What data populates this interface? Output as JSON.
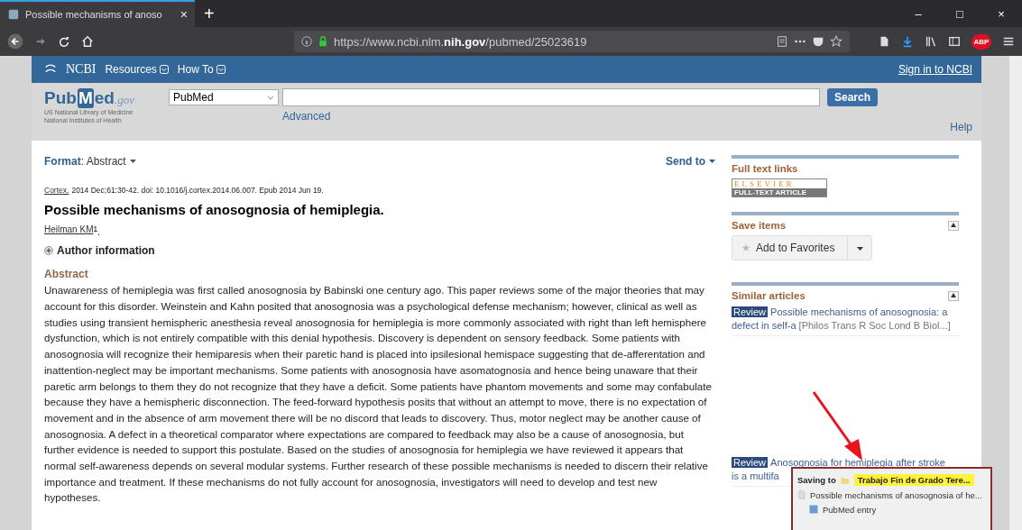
{
  "browser": {
    "tab": {
      "title": "Possible mechanisms of anoso",
      "close": "×"
    },
    "new_tab": "+",
    "window_controls": [
      "–",
      "□",
      "×"
    ],
    "url": "https://www.ncbi.nlm.**nih.gov**/pubmed/25023619",
    "adblock_badge": "ABP"
  },
  "ncbi_bar": {
    "logo": "NCBI",
    "menus": [
      {
        "label": "Resources"
      },
      {
        "label": "How To"
      }
    ],
    "sign_in": "Sign in to NCBI"
  },
  "pubmed_header": {
    "logo_parts": [
      "Pub",
      "M",
      "ed",
      ".gov"
    ],
    "org_lines": [
      "US National Library of Medicine",
      "National Institutes of Health"
    ],
    "database": "PubMed",
    "advanced": "Advanced",
    "search_button": "Search",
    "help": "Help"
  },
  "article": {
    "format": "**Format**: Abstract",
    "send_to": "Send to",
    "journal": "Cortex.",
    "citation": "2014 Dec;61:30-42. doi: 10.1016/j.cortex.2014.06.007. Epub 2014 Jun 19.",
    "title": "Possible mechanisms of anosognosia of hemiplegia.",
    "author": "Heilman KM",
    "author_note": "$^{1}$.",
    "author_info": "Author information",
    "abstract_heading": "Abstract",
    "abstract": "Unawareness of hemiplegia was first called anosognosia by Babinski one century ago. This paper reviews some of the major theories that may account for this disorder. Weinstein and Kahn posited that anosognosia was a psychological defense mechanism; however, clinical as well as studies using transient hemispheric anesthesia reveal anosognosia for hemiplegia is more commonly associated with right than left hemisphere dysfunction, which is not entirely compatible with this denial hypothesis. Discovery is dependent on sensory feedback. Some patients with anosognosia will recognize their hemiparesis when their paretic hand is placed into ipsilesional hemispace suggesting that de-afferentation and inattention-neglect may be important mechanisms. Some patients with anosognosia have asomatognosia and hence being unaware that their paretic arm belongs to them they do not recognize that they have a deficit. Some patients have phantom movements and some may confabulate because they have a hemispheric disconnection. The feed-forward hypothesis posits that without an attempt to move, there is no expectation of movement and in the absence of arm movement there will be no discord that leads to discovery. Thus, motor neglect may be another cause of anosognosia. A defect in a theoretical comparator where expectations are compared to feedback may also be a cause of anosognosia, but further evidence is needed to support this postulate. Based on the studies of anosognosia for hemiplegia we have reviewed it appears that normal self-awareness depends on several modular systems. Further research of these possible mechanisms is needed to discern their relative importance and treatment. If these mechanisms do not fully account for anosognosia, investigators will need to develop and test new hypotheses."
  },
  "sidebar": {
    "full_text": {
      "heading": "Full text links",
      "badge_top": "ELSEVIER",
      "badge_bottom": "FULL-TEXT ARTICLE"
    },
    "save_items": {
      "heading": "Save items",
      "expanded": true,
      "button": "Add to Favorites"
    },
    "similar": {
      "heading": "Similar articles",
      "expanded": true,
      "items": [
        {
          "tag": "Review",
          "lines": [
            "Possible mechanisms of anosognosia: a",
            "defect in self-a"
          ],
          "source": "[Philos Trans R Soc Lond B Biol...]"
        },
        {
          "tag": "Review",
          "lines": [
            "Anosognosia for hemiplegia after stroke",
            "is a multifa"
          ]
        }
      ]
    }
  },
  "saving_popup": {
    "label": "Saving to",
    "folder": "Trabajo Fin de Grado Tere...",
    "item": "Possible mechanisms of anosognosia of he...",
    "sub_item": "PubMed entry"
  }
}
